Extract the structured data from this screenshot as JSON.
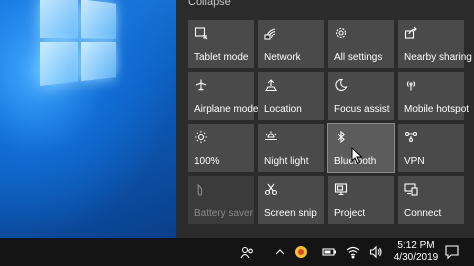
{
  "panel": {
    "collapse_label": "Collapse"
  },
  "tiles": [
    {
      "label": "Tablet mode",
      "icon": "tablet-mode-icon"
    },
    {
      "label": "Network",
      "icon": "network-icon"
    },
    {
      "label": "All settings",
      "icon": "gear-icon"
    },
    {
      "label": "Nearby sharing",
      "icon": "share-icon"
    },
    {
      "label": "Airplane mode",
      "icon": "airplane-icon"
    },
    {
      "label": "Location",
      "icon": "location-icon"
    },
    {
      "label": "Focus assist",
      "icon": "moon-icon"
    },
    {
      "label": "Mobile hotspot",
      "icon": "hotspot-icon"
    },
    {
      "label": "100%",
      "icon": "brightness-icon"
    },
    {
      "label": "Night light",
      "icon": "night-light-icon"
    },
    {
      "label": "Bluetooth",
      "icon": "bluetooth-icon"
    },
    {
      "label": "VPN",
      "icon": "vpn-icon"
    },
    {
      "label": "Battery saver",
      "icon": "battery-saver-icon"
    },
    {
      "label": "Screen snip",
      "icon": "screen-snip-icon"
    },
    {
      "label": "Project",
      "icon": "project-icon"
    },
    {
      "label": "Connect",
      "icon": "connect-icon"
    }
  ],
  "taskbar": {
    "time": "5:12 PM",
    "date": "4/30/2019"
  },
  "colors": {
    "tile_bg": "#4a4a4a",
    "panel_bg": "#2b2b2b",
    "taskbar_bg": "#141414"
  }
}
